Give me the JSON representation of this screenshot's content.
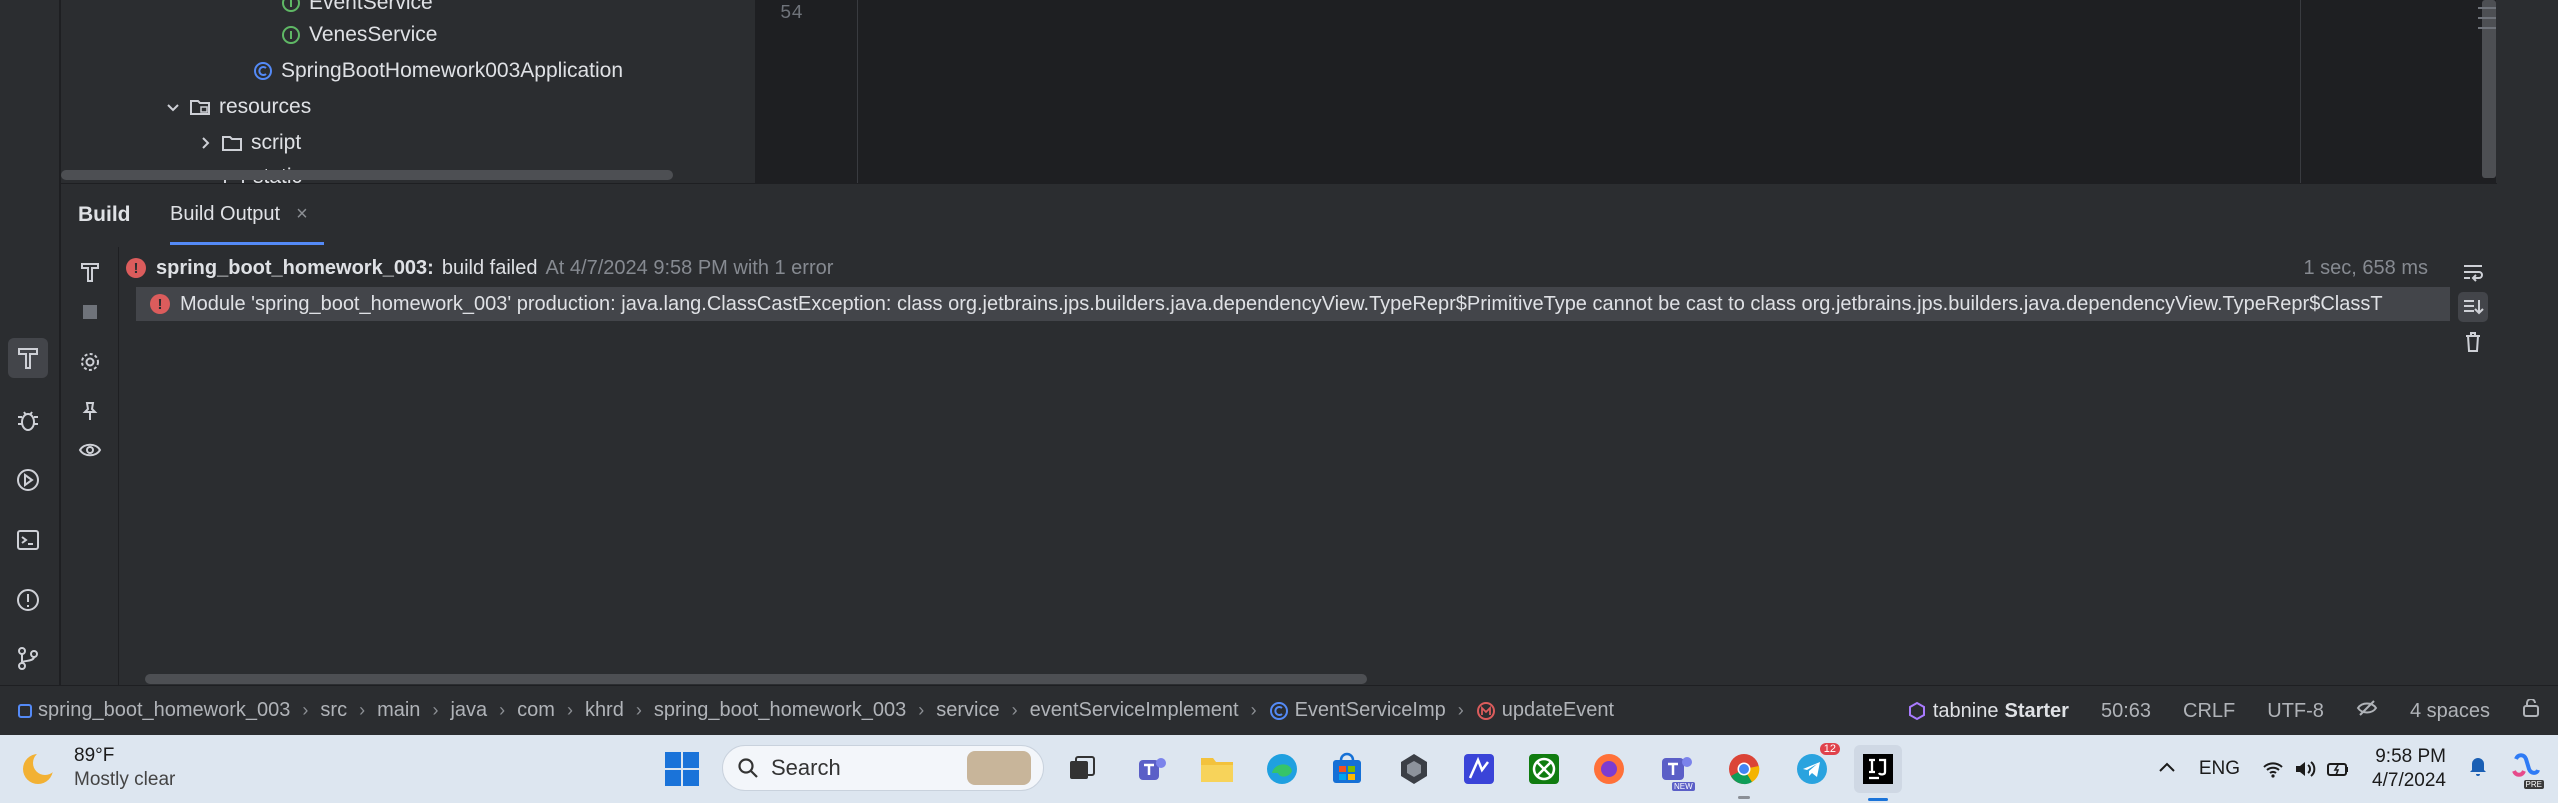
{
  "tree": {
    "items": [
      {
        "label": "EventService",
        "kind": "interface"
      },
      {
        "label": "VenesService",
        "kind": "interface"
      },
      {
        "label": "SpringBootHomework003Application",
        "kind": "app-class"
      },
      {
        "label": "resources",
        "kind": "folder-open"
      },
      {
        "label": "script",
        "kind": "folder-closed"
      },
      {
        "label": "static",
        "kind": "folder"
      }
    ]
  },
  "editor": {
    "line_number": "54"
  },
  "build": {
    "title": "Build",
    "tab_label": "Build Output",
    "tab_close": "×",
    "summary_project": "spring_boot_homework_003:",
    "summary_status": "build failed",
    "summary_detail": "At 4/7/2024 9:58 PM with 1 error",
    "duration": "1 sec, 658 ms",
    "error_message": "Module 'spring_boot_homework_003' production: java.lang.ClassCastException: class org.jetbrains.jps.builders.java.dependencyView.TypeRepr$PrimitiveType cannot be cast to class org.jetbrains.jps.builders.java.dependencyView.TypeRepr$ClassT"
  },
  "breadcrumbs": [
    "spring_boot_homework_003",
    "src",
    "main",
    "java",
    "com",
    "khrd",
    "spring_boot_homework_003",
    "service",
    "eventServiceImplement",
    "EventServiceImp",
    "updateEvent"
  ],
  "status": {
    "tabnine_brand": "tabnine",
    "tabnine_plan": "Starter",
    "position": "50:63",
    "line_ending": "CRLF",
    "encoding": "UTF-8",
    "indent": "4 spaces"
  },
  "taskbar": {
    "temperature": "89°F",
    "weather": "Mostly clear",
    "search_placeholder": "Search",
    "language": "ENG",
    "time": "9:58 PM",
    "date": "4/7/2024",
    "telegram_badge": "12",
    "teams_badge": "NEW",
    "copilot_badge": "PRE"
  },
  "colors": {
    "error": "#db5c5c",
    "accent": "#548af7",
    "interface_icon": "#5fb865",
    "app_class_icon": "#548af7"
  }
}
